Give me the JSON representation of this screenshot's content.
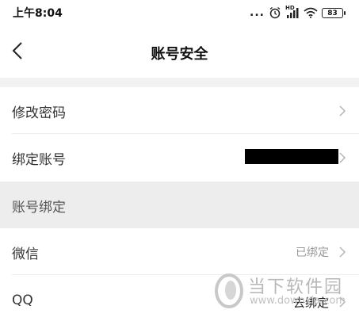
{
  "status_bar": {
    "time": "上午8:04",
    "dots": "...",
    "battery": "83",
    "hd_label": "HD"
  },
  "nav": {
    "title": "账号安全"
  },
  "rows": [
    {
      "label": "修改密码"
    },
    {
      "label": "绑定账号"
    }
  ],
  "section": {
    "title": "账号绑定"
  },
  "bindings": [
    {
      "label": "微信",
      "value": "已绑定"
    },
    {
      "label": "QQ",
      "value": "去绑定"
    }
  ],
  "watermark": {
    "name": "当下软件园",
    "url": "www.downxia.com"
  }
}
